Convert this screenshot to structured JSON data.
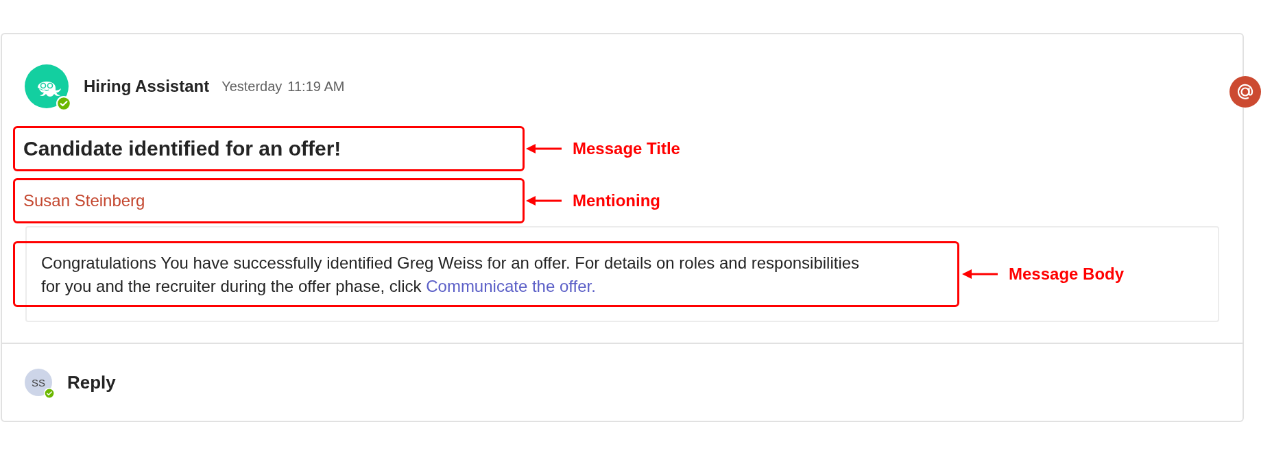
{
  "message": {
    "sender": "Hiring Assistant",
    "day": "Yesterday",
    "time": "11:19 AM",
    "title": "Candidate identified for an offer!",
    "mention": "Susan Steinberg",
    "body": {
      "text": "Congratulations You have successfully identified Greg Weiss for an offer. For details on roles and responsibilities for you and the recruiter during the offer phase, click ",
      "link": "Communicate the offer."
    }
  },
  "annotations": [
    "Message Title",
    "Mentioning",
    "Message Body"
  ],
  "reply": {
    "initials": "SS",
    "label": "Reply"
  }
}
